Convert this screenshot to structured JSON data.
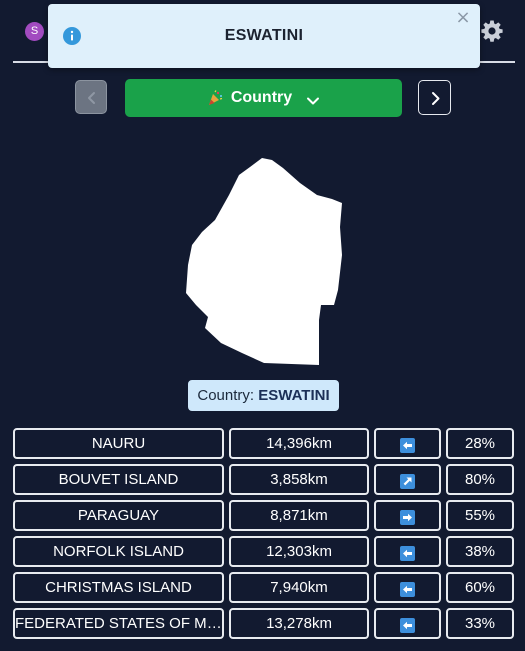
{
  "header": {
    "avatar_letter": "S",
    "settings_icon": "gear-icon"
  },
  "toast": {
    "icon": "info-icon",
    "title": "ESWATINI",
    "close_label": "×"
  },
  "nav": {
    "prev_icon": "chevron-left-icon",
    "next_icon": "chevron-right-icon",
    "category_icon": "party-popper-icon",
    "category_label": "Country",
    "dropdown_icon": "chevron-down-icon"
  },
  "answer": {
    "prefix": "Country:",
    "value": "ESWATINI"
  },
  "guesses": [
    {
      "name": "NAURU",
      "distance": "14,396km",
      "direction": "left",
      "percent": "28%"
    },
    {
      "name": "BOUVET ISLAND",
      "distance": "3,858km",
      "direction": "up-right",
      "percent": "80%"
    },
    {
      "name": "PARAGUAY",
      "distance": "8,871km",
      "direction": "right",
      "percent": "55%"
    },
    {
      "name": "NORFOLK ISLAND",
      "distance": "12,303km",
      "direction": "left",
      "percent": "38%"
    },
    {
      "name": "CHRISTMAS ISLAND",
      "distance": "7,940km",
      "direction": "left",
      "percent": "60%"
    },
    {
      "name": "FEDERATED STATES OF MICRONESIA",
      "distance": "13,278km",
      "direction": "left",
      "percent": "33%"
    }
  ],
  "colors": {
    "background": "#121a30",
    "category_button": "#1aa24a",
    "toast_bg": "#dff0fb",
    "answer_bg": "#cfe8fb",
    "direction_icon": "#3d8fdc"
  }
}
